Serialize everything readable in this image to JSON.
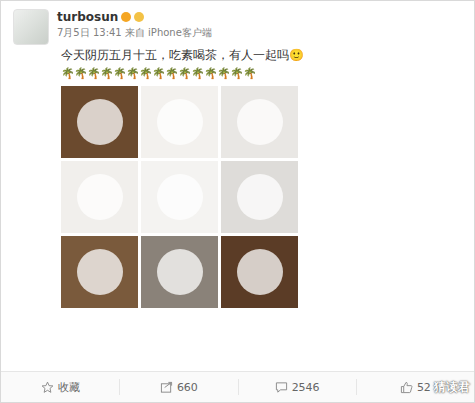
{
  "post": {
    "username": "turbosun",
    "meta": "7月5日 13:41 来自 iPhone客户端",
    "text": "今天阴历五月十五，吃素喝茶，有人一起吗🙂",
    "decoration": "🌴🌴🌴🌴🌴🌴🌴🌴🌴🌴🌴🌴🌴🌴🌴"
  },
  "actions": [
    {
      "label": "收藏",
      "icon": "star"
    },
    {
      "label": "660",
      "icon": "share"
    },
    {
      "label": "2546",
      "icon": "comment"
    },
    {
      "label": "52",
      "icon": "like"
    }
  ],
  "watermark": "猜读君"
}
